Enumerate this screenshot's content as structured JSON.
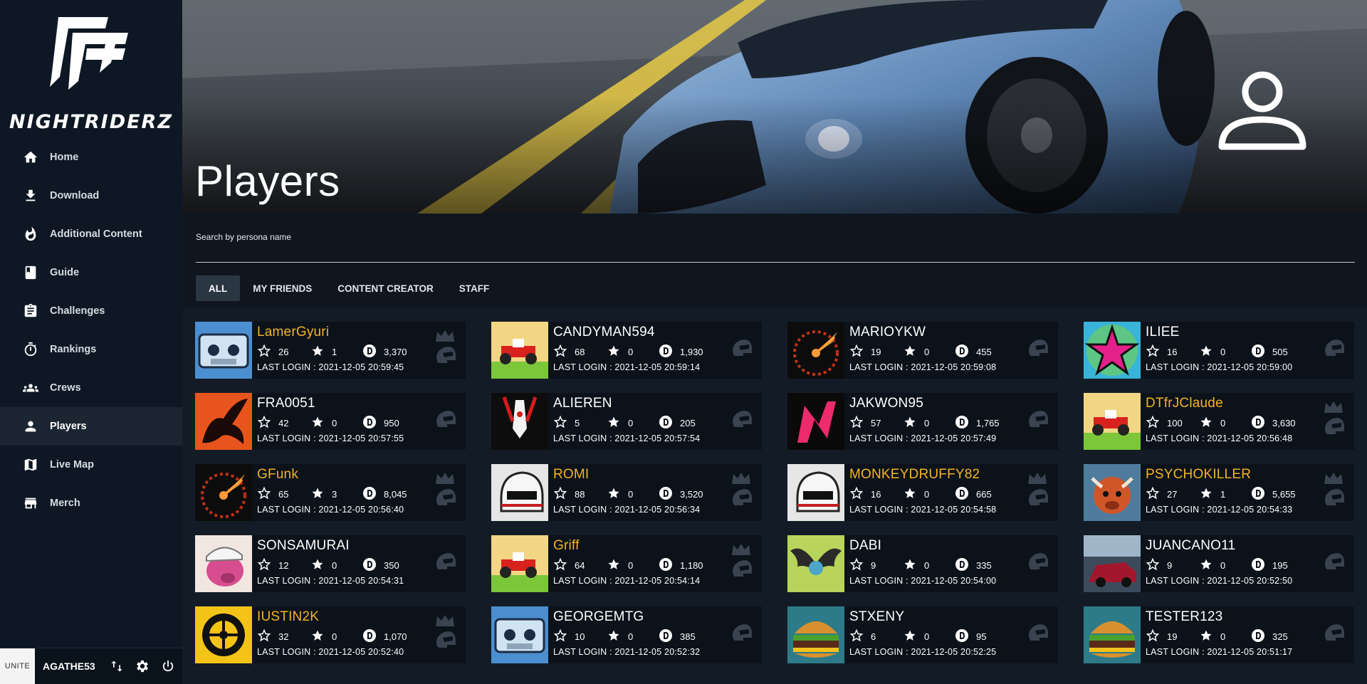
{
  "app": {
    "brand": "NIGHTRIDERZ"
  },
  "sidebar": {
    "items": [
      {
        "label": "Home",
        "icon": "home-icon",
        "active": false
      },
      {
        "label": "Download",
        "icon": "download-icon",
        "active": false
      },
      {
        "label": "Additional Content",
        "icon": "fire-icon",
        "active": false
      },
      {
        "label": "Guide",
        "icon": "book-icon",
        "active": false
      },
      {
        "label": "Challenges",
        "icon": "clipboard-icon",
        "active": false
      },
      {
        "label": "Rankings",
        "icon": "timer-icon",
        "active": false
      },
      {
        "label": "Crews",
        "icon": "group-icon",
        "active": false
      },
      {
        "label": "Players",
        "icon": "person-icon",
        "active": true
      },
      {
        "label": "Live Map",
        "icon": "map-icon",
        "active": false
      },
      {
        "label": "Merch",
        "icon": "store-icon",
        "active": false
      }
    ],
    "user": {
      "badge": "UNITE",
      "name": "AGATHE53"
    }
  },
  "hero": {
    "title": "Players"
  },
  "search": {
    "label": "Search by persona name",
    "value": ""
  },
  "tabs": [
    {
      "label": "ALL",
      "active": true
    },
    {
      "label": "MY FRIENDS",
      "active": false
    },
    {
      "label": "CONTENT CREATOR",
      "active": false
    },
    {
      "label": "STAFF",
      "active": false
    }
  ],
  "colors": {
    "highlight_name": "#f5b324",
    "normal_name": "#ffffff",
    "active_tab": "#2b3643"
  },
  "players": [
    {
      "name": "LamerGyuri",
      "gold": true,
      "level": "26",
      "trophies": "1",
      "coins": "3,370",
      "last_login": "LAST LOGIN : 2021-12-05 20:59:45",
      "avatar": "tape"
    },
    {
      "name": "CANDYMAN594",
      "gold": false,
      "level": "68",
      "trophies": "0",
      "coins": "1,930",
      "last_login": "LAST LOGIN : 2021-12-05 20:59:14",
      "avatar": "kart"
    },
    {
      "name": "MARIOYKW",
      "gold": false,
      "level": "19",
      "trophies": "0",
      "coins": "455",
      "last_login": "LAST LOGIN : 2021-12-05 20:59:08",
      "avatar": "gauge"
    },
    {
      "name": "ILIEE",
      "gold": false,
      "level": "16",
      "trophies": "0",
      "coins": "505",
      "last_login": "LAST LOGIN : 2021-12-05 20:59:00",
      "avatar": "star"
    },
    {
      "name": "FRA0051",
      "gold": false,
      "level": "42",
      "trophies": "0",
      "coins": "950",
      "last_login": "LAST LOGIN : 2021-12-05 20:57:55",
      "avatar": "phoenix"
    },
    {
      "name": "ALIEREN",
      "gold": false,
      "level": "5",
      "trophies": "0",
      "coins": "205",
      "last_login": "LAST LOGIN : 2021-12-05 20:57:54",
      "avatar": "rocket"
    },
    {
      "name": "JAKWON95",
      "gold": false,
      "level": "57",
      "trophies": "0",
      "coins": "1,765",
      "last_login": "LAST LOGIN : 2021-12-05 20:57:49",
      "avatar": "nfs"
    },
    {
      "name": "DTfrJClaude",
      "gold": true,
      "level": "100",
      "trophies": "0",
      "coins": "3,630",
      "last_login": "LAST LOGIN : 2021-12-05 20:56:48",
      "avatar": "kart"
    },
    {
      "name": "GFunk",
      "gold": true,
      "level": "65",
      "trophies": "3",
      "coins": "8,045",
      "last_login": "LAST LOGIN : 2021-12-05 20:56:40",
      "avatar": "gauge"
    },
    {
      "name": "ROMI",
      "gold": true,
      "level": "88",
      "trophies": "0",
      "coins": "3,520",
      "last_login": "LAST LOGIN : 2021-12-05 20:56:34",
      "avatar": "helmet"
    },
    {
      "name": "MONKEYDRUFFY82",
      "gold": true,
      "level": "16",
      "trophies": "0",
      "coins": "665",
      "last_login": "LAST LOGIN : 2021-12-05 20:54:58",
      "avatar": "helmet"
    },
    {
      "name": "PSYCHOKILLER",
      "gold": true,
      "level": "27",
      "trophies": "1",
      "coins": "5,655",
      "last_login": "LAST LOGIN : 2021-12-05 20:54:33",
      "avatar": "bull"
    },
    {
      "name": "SONSAMURAI",
      "gold": false,
      "level": "12",
      "trophies": "0",
      "coins": "350",
      "last_login": "LAST LOGIN : 2021-12-05 20:54:31",
      "avatar": "pig"
    },
    {
      "name": "Griff",
      "gold": true,
      "level": "64",
      "trophies": "0",
      "coins": "1,180",
      "last_login": "LAST LOGIN : 2021-12-05 20:54:14",
      "avatar": "kart"
    },
    {
      "name": "DABI",
      "gold": false,
      "level": "9",
      "trophies": "0",
      "coins": "335",
      "last_login": "LAST LOGIN : 2021-12-05 20:54:00",
      "avatar": "wings"
    },
    {
      "name": "JUANCANO11",
      "gold": false,
      "level": "9",
      "trophies": "0",
      "coins": "195",
      "last_login": "LAST LOGIN : 2021-12-05 20:52:50",
      "avatar": "car"
    },
    {
      "name": "IUSTIN2K",
      "gold": true,
      "level": "32",
      "trophies": "0",
      "coins": "1,070",
      "last_login": "LAST LOGIN : 2021-12-05 20:52:40",
      "avatar": "wheel"
    },
    {
      "name": "GEORGEMTG",
      "gold": false,
      "level": "10",
      "trophies": "0",
      "coins": "385",
      "last_login": "LAST LOGIN : 2021-12-05 20:52:32",
      "avatar": "tape"
    },
    {
      "name": "STXENY",
      "gold": false,
      "level": "6",
      "trophies": "0",
      "coins": "95",
      "last_login": "LAST LOGIN : 2021-12-05 20:52:25",
      "avatar": "burger"
    },
    {
      "name": "TESTER123",
      "gold": false,
      "level": "19",
      "trophies": "0",
      "coins": "325",
      "last_login": "LAST LOGIN : 2021-12-05 20:51:17",
      "avatar": "burger"
    }
  ]
}
